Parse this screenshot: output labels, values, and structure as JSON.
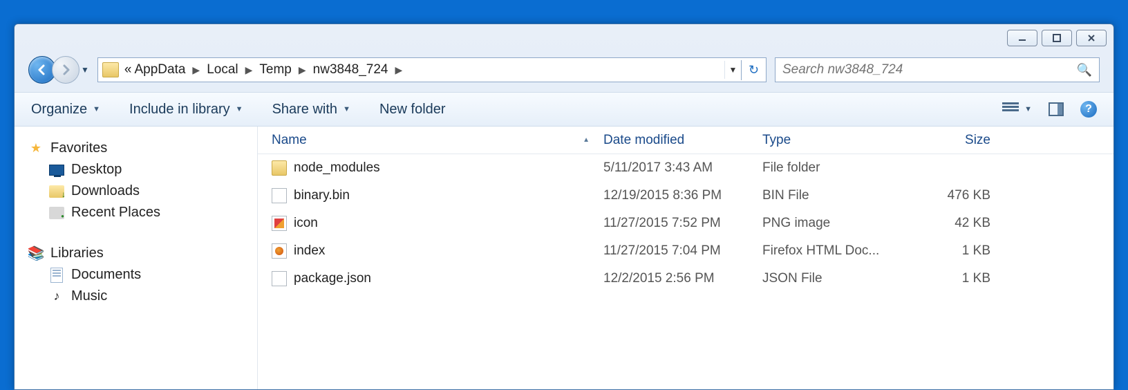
{
  "breadcrumb": {
    "prefix": "«",
    "segments": [
      "AppData",
      "Local",
      "Temp",
      "nw3848_724"
    ]
  },
  "search": {
    "placeholder": "Search nw3848_724"
  },
  "toolbar": {
    "organize": "Organize",
    "include": "Include in library",
    "share": "Share with",
    "newfolder": "New folder"
  },
  "columns": {
    "name": "Name",
    "date": "Date modified",
    "type": "Type",
    "size": "Size"
  },
  "sidebar": {
    "favorites": {
      "label": "Favorites",
      "items": [
        "Desktop",
        "Downloads",
        "Recent Places"
      ]
    },
    "libraries": {
      "label": "Libraries",
      "items": [
        "Documents",
        "Music"
      ]
    }
  },
  "files": [
    {
      "icon": "folder",
      "name": "node_modules",
      "date": "5/11/2017 3:43 AM",
      "type": "File folder",
      "size": ""
    },
    {
      "icon": "file",
      "name": "binary.bin",
      "date": "12/19/2015 8:36 PM",
      "type": "BIN File",
      "size": "476 KB"
    },
    {
      "icon": "png",
      "name": "icon",
      "date": "11/27/2015 7:52 PM",
      "type": "PNG image",
      "size": "42 KB"
    },
    {
      "icon": "html",
      "name": "index",
      "date": "11/27/2015 7:04 PM",
      "type": "Firefox HTML Doc...",
      "size": "1 KB"
    },
    {
      "icon": "file",
      "name": "package.json",
      "date": "12/2/2015 2:56 PM",
      "type": "JSON File",
      "size": "1 KB"
    }
  ]
}
